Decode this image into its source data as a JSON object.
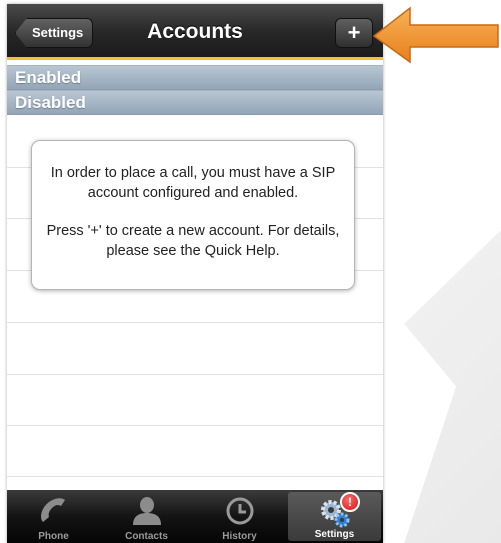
{
  "navbar": {
    "back_label": "Settings",
    "title": "Accounts",
    "add_label": "+"
  },
  "sections": {
    "enabled": "Enabled",
    "disabled": "Disabled"
  },
  "alert": {
    "line1": "In order to place a call, you must have a SIP account configured and enabled.",
    "line2": "Press '+' to create a new account. For details, please see the Quick Help."
  },
  "tabbar": {
    "tabs": [
      {
        "label": "Phone",
        "icon": "phone-icon"
      },
      {
        "label": "Contacts",
        "icon": "contacts-icon"
      },
      {
        "label": "History",
        "icon": "history-icon"
      },
      {
        "label": "Settings",
        "icon": "settings-gears-icon",
        "active": true
      }
    ],
    "settings_badge": "!"
  },
  "colors": {
    "accent_line": "#f1c232",
    "arrow": "#f0932b",
    "section_header": "#a8b8c8",
    "badge": "#d11414"
  }
}
